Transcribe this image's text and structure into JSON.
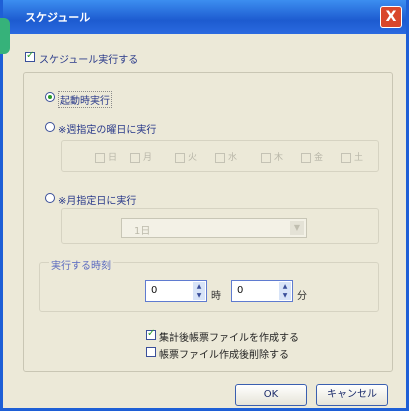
{
  "window": {
    "title": "スケジュール",
    "close": "X"
  },
  "schedule_enable": {
    "label": "スケジュール実行する",
    "checked": true
  },
  "options": {
    "startup_label": "起動時実行",
    "weekly_label": "※週指定の曜日に実行",
    "days": [
      "日",
      "月",
      "火",
      "水",
      "木",
      "金",
      "土"
    ],
    "monthly_label": "※月指定日に実行",
    "monthly_value": "1日"
  },
  "time": {
    "section_label": "実行する時刻",
    "hour_value": "0",
    "hour_unit": "時",
    "minute_value": "0",
    "minute_unit": "分"
  },
  "checks": {
    "create_log": "集計後帳票ファイルを作成する",
    "delete_log": "帳票ファイル作成後削除する"
  },
  "buttons": {
    "ok": "OK",
    "cancel": "キャンセル"
  }
}
